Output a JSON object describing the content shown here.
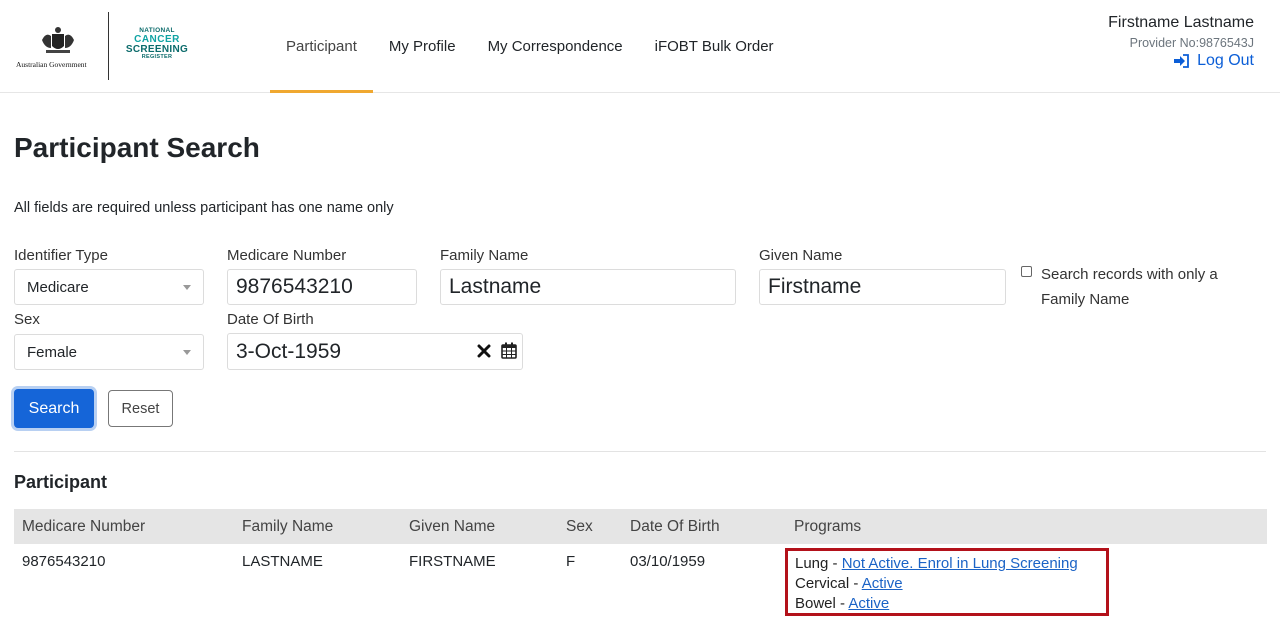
{
  "header": {
    "gov_logo_text": "Australian Government",
    "ncsr_logo": [
      "NATIONAL",
      "CANCER",
      "SCREENING",
      "REGISTER"
    ],
    "nav": [
      "Participant",
      "My Profile",
      "My Correspondence",
      "iFOBT Bulk Order"
    ],
    "active_nav": "Participant",
    "user_name": "Firstname Lastname",
    "provider_no": "Provider No:9876543J",
    "logout_label": "Log Out"
  },
  "page": {
    "title": "Participant Search",
    "instructions": "All fields are required unless participant has one name only"
  },
  "form": {
    "identifier_type": {
      "label": "Identifier Type",
      "value": "Medicare"
    },
    "medicare_number": {
      "label": "Medicare Number",
      "value": "9876543210"
    },
    "family_name": {
      "label": "Family Name",
      "value": "Lastname"
    },
    "given_name": {
      "label": "Given Name",
      "value": "Firstname"
    },
    "family_only": {
      "label": "Search records with only a Family Name",
      "checked": false
    },
    "sex": {
      "label": "Sex",
      "value": "Female"
    },
    "dob": {
      "label": "Date Of Birth",
      "value": "3-Oct-1959"
    },
    "search_label": "Search",
    "reset_label": "Reset"
  },
  "results": {
    "title": "Participant",
    "columns": [
      "Medicare Number",
      "Family Name",
      "Given Name",
      "Sex",
      "Date Of Birth",
      "Programs"
    ],
    "rows": [
      {
        "medicare_number": "9876543210",
        "family_name": "LASTNAME",
        "given_name": "FIRSTNAME",
        "sex": "F",
        "dob": "03/10/1959",
        "programs": [
          {
            "name": "Lung",
            "status": "Not Active. Enrol in Lung Screening"
          },
          {
            "name": "Cervical",
            "status": "Active"
          },
          {
            "name": "Bowel",
            "status": "Active"
          }
        ]
      }
    ]
  },
  "colors": {
    "primary": "#1565d8",
    "active_tab": "#f0a830",
    "highlight_border": "#b3111a",
    "link": "#1b63c6"
  }
}
